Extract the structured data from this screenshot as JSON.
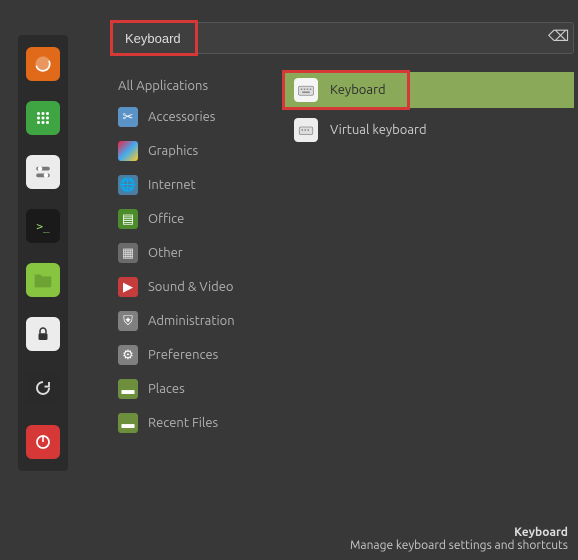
{
  "search": {
    "value": "Keyboard"
  },
  "launcher": [
    {
      "name": "firefox",
      "bg": "#e06a1a",
      "glyph": "◯"
    },
    {
      "name": "apps",
      "bg": "#3fa543",
      "glyph": "⋮⋮⋮"
    },
    {
      "name": "settings-toggle",
      "bg": "#ececec",
      "glyph": "⇅"
    },
    {
      "name": "terminal",
      "bg": "#1a1a1a",
      "glyph": ">_"
    },
    {
      "name": "files",
      "bg": "#87c540",
      "glyph": ""
    },
    {
      "name": "lock",
      "bg": "#ececec",
      "glyph": "🔒"
    },
    {
      "name": "restart",
      "bg": "#2a2a2a",
      "glyph": "⟳"
    },
    {
      "name": "power",
      "bg": "#d63838",
      "glyph": "⏻"
    }
  ],
  "categories": [
    {
      "id": "all",
      "label": "All Applications"
    },
    {
      "id": "accessories",
      "label": "Accessories"
    },
    {
      "id": "graphics",
      "label": "Graphics"
    },
    {
      "id": "internet",
      "label": "Internet"
    },
    {
      "id": "office",
      "label": "Office"
    },
    {
      "id": "other",
      "label": "Other"
    },
    {
      "id": "sound-video",
      "label": "Sound & Video"
    },
    {
      "id": "administration",
      "label": "Administration"
    },
    {
      "id": "preferences",
      "label": "Preferences"
    },
    {
      "id": "places",
      "label": "Places"
    },
    {
      "id": "recent",
      "label": "Recent Files"
    }
  ],
  "results": [
    {
      "id": "keyboard",
      "label": "Keyboard",
      "selected": true
    },
    {
      "id": "virtual-keyboard",
      "label": "Virtual keyboard",
      "selected": false
    }
  ],
  "footer": {
    "title": "Keyboard",
    "desc": "Manage keyboard settings and shortcuts"
  }
}
